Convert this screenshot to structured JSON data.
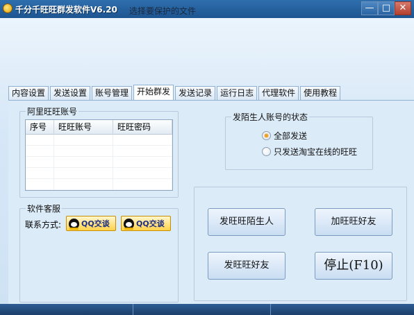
{
  "window": {
    "title": "千分千旺旺群发软件V6.20",
    "overlay_text": "选择要保护的文件",
    "controls": {
      "minimize": "—",
      "maximize": "□",
      "close": "✕"
    }
  },
  "tabs": [
    {
      "label": "内容设置",
      "active": false
    },
    {
      "label": "发送设置",
      "active": false
    },
    {
      "label": "账号管理",
      "active": false
    },
    {
      "label": "开始群发",
      "active": true
    },
    {
      "label": "发送记录",
      "active": false
    },
    {
      "label": "运行日志",
      "active": false
    },
    {
      "label": "代理软件",
      "active": false
    },
    {
      "label": "使用教程",
      "active": false
    }
  ],
  "accounts": {
    "group_title": "阿里旺旺账号",
    "columns": [
      "序号",
      "旺旺账号",
      "旺旺密码"
    ],
    "rows": []
  },
  "status_group": {
    "title": "发陌生人账号的状态",
    "options": [
      {
        "label": "全部发送",
        "checked": true
      },
      {
        "label": "只发送淘宝在线的旺旺",
        "checked": false
      }
    ]
  },
  "service": {
    "title": "软件客服",
    "contact_label": "联系方式:",
    "qq_buttons": [
      "QQ交谈",
      "QQ交谈"
    ]
  },
  "actions": {
    "send_strangers": "发旺旺陌生人",
    "add_friends": "加旺旺好友",
    "send_friends": "发旺旺好友",
    "stop": "停止(F10)"
  },
  "colors": {
    "titlebar": "#1d5590",
    "client_bg": "#dcebf8",
    "radio_checked": "#f0a020",
    "qq_button": "#ffd24a"
  }
}
